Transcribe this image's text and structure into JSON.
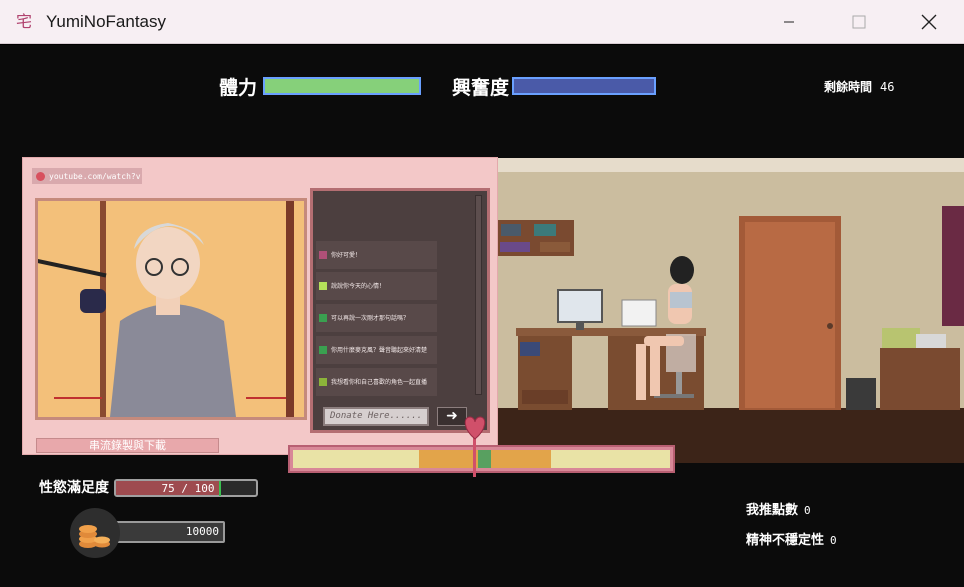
{
  "window": {
    "title": "YumiNoFantasy",
    "icon_glyph": "宅"
  },
  "hud": {
    "stamina_label": "體力",
    "stamina_level": 1.0,
    "excitement_label": "興奮度",
    "excitement_level": 1.0,
    "time_label": "剩餘時間",
    "time_value": "46"
  },
  "stream": {
    "url": "youtube.com/watch?v",
    "chat": [
      {
        "text": "你好可愛！",
        "color": "#b05078"
      },
      {
        "text": "說說你今天的心情！",
        "color": "#b4e05a"
      },
      {
        "text": "可以再說一次剛才那句話嗎？",
        "color": "#3aa050"
      },
      {
        "text": "你用什麼麥克風？聲音聽起來好清楚",
        "color": "#3aa050"
      },
      {
        "text": "我想看你和自己喜歡的角色一起直播",
        "color": "#8cb43a"
      }
    ],
    "donate_placeholder": "Donate Here......",
    "send_icon": "arrow-right-icon",
    "record_label": "串流錄製與下載"
  },
  "satisfaction": {
    "label": "性慾滿足度",
    "current": 75,
    "max": 100,
    "text": "75 / 100"
  },
  "money": {
    "value": "10000",
    "icon": "coin-stack-icon"
  },
  "side_stats": {
    "oshi_label": "我推點數",
    "oshi_value": "0",
    "instability_label": "精神不穩定性",
    "instability_value": "0"
  },
  "colors": {
    "stamina": "#86d07a",
    "excitement": "#4a5aa8",
    "heart": "#d0506a"
  }
}
